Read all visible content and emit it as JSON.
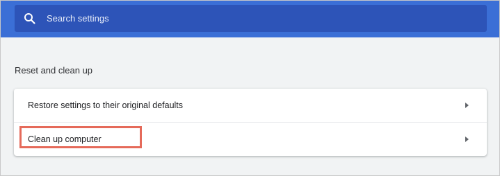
{
  "search": {
    "placeholder": "Search settings",
    "icon": "search-icon"
  },
  "section": {
    "title": "Reset and clean up"
  },
  "items": [
    {
      "label": "Restore settings to their original defaults",
      "icon": "chevron-right-icon"
    },
    {
      "label": "Clean up computer",
      "icon": "chevron-right-icon",
      "highlighted": true
    }
  ],
  "colors": {
    "header": "#3b6fd6",
    "search_field": "#2d54b8",
    "page_background": "#f1f3f4",
    "card_background": "#ffffff",
    "highlight": "#e56a5a"
  }
}
